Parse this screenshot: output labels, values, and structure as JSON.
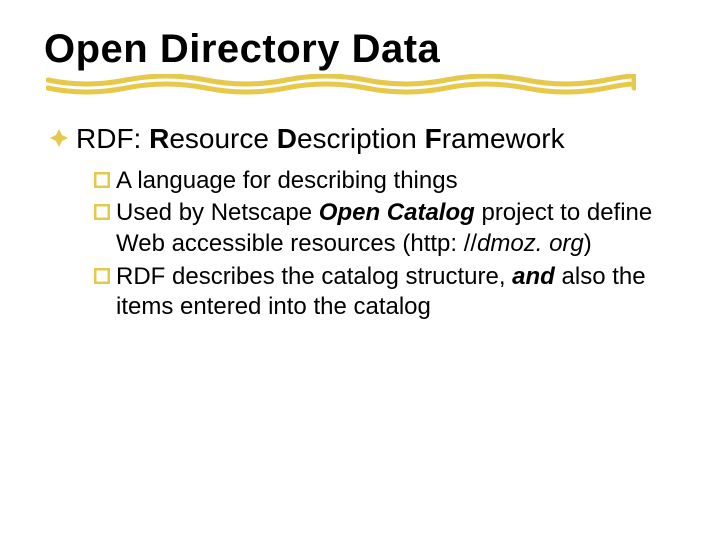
{
  "title": "Open Directory Data",
  "heading": {
    "abbrev": "RDF:",
    "rword": "R",
    "rrest": "esource ",
    "dword": "D",
    "drest": "escription ",
    "fword": "F",
    "frest": "ramework"
  },
  "items": {
    "i1": "A language for describing things",
    "i2a": "Used by Netscape ",
    "i2b": "Open Catalog",
    "i2c": " project to define Web accessible resources (http: //",
    "i2d": "dmoz. org",
    "i2e": ")",
    "i3a": "RDF describes the catalog structure, ",
    "i3b": "and",
    "i3c": " also the items entered into the catalog"
  }
}
